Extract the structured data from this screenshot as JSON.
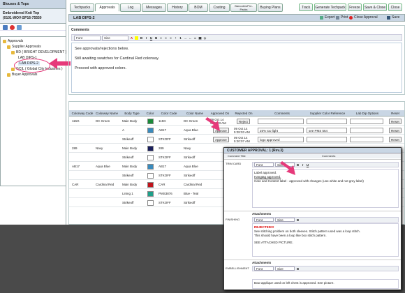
{
  "sidebar": {
    "title": "Blouses & Tops",
    "subtitle1": "Embroidered Knit Top",
    "subtitle2": "(0101-WOV-SP16-75550",
    "tree": [
      "Approvals",
      "Supplier Approvals",
      "BD ( BRIGHT DEVELOPMENT )",
      "LAB DIPS-1",
      "LAB DIPS-2",
      "GCIL ( Global City Industries )",
      "Buyer Approvals"
    ]
  },
  "tabs": [
    "Techpacks",
    "Approvals",
    "Log",
    "Messages",
    "History",
    "BOM",
    "Costing",
    "Barcodes/Pre-Packs",
    "Buying Plans"
  ],
  "buttons": [
    "Track",
    "Generate Techpack",
    "Freeze",
    "Save & Close",
    "Close"
  ],
  "header": {
    "title": "LAB DIPS-2",
    "export": "Export",
    "print": "Print",
    "close_approval": "Close Approval",
    "save": "Save"
  },
  "comments": {
    "label": "Comments",
    "font": "Font",
    "size": "Size",
    "lines": [
      "See approvals/rejections below.",
      "Still awaiting swatches for Cardinal Red colorway.",
      "Proceed with approved colors."
    ]
  },
  "grid": {
    "headers": [
      "Colorway Code",
      "Colorway Name",
      "Body Type",
      "Color",
      "Color Code",
      "Color Name",
      "Approved On",
      "Rejected On",
      "Comments",
      "Supplier Color Reference",
      "Lab Dip Options",
      "Reset"
    ],
    "rows": [
      {
        "cc": "115G",
        "cn": "DC Green",
        "bt": "Main Body",
        "sw": "#1b8a3a",
        "code": "115G",
        "name": "DC Green",
        "appr": "09 Oct 14\n5:28:03 AM",
        "rej": "Reject",
        "comm": "",
        "ref": "",
        "reset": "Reset"
      },
      {
        "cc": "",
        "cn": "",
        "bt": "A",
        "sw": "#3a8bbd",
        "code": "AB17",
        "name": "Aqua Blue",
        "appr": "Approve",
        "rej": "09 Oct 14\n5:28:03 AM",
        "comm": "25% too light",
        "ref": "see PMS 564",
        "reset": "Reset"
      },
      {
        "cc": "",
        "cn": "",
        "bt": "Strikeoff",
        "sw": "#ffffff",
        "code": "STKOFF",
        "name": "Strikeoff",
        "appr": "Approve",
        "rej": "09 Oct 14\n5:20:07 AM",
        "comm": "logo approved",
        "ref": "",
        "reset": "Reset"
      },
      {
        "cc": "289",
        "cn": "Navy",
        "bt": "Main Body",
        "sw": "#1a1f5c",
        "code": "289",
        "name": "Navy",
        "appr": "",
        "rej": "",
        "comm": "",
        "ref": "",
        "reset": ""
      },
      {
        "cc": "",
        "cn": "",
        "bt": "Strikeoff",
        "sw": "#ffffff",
        "code": "STKOFF",
        "name": "Strikeoff",
        "appr": "",
        "rej": "",
        "comm": "",
        "ref": "",
        "reset": ""
      },
      {
        "cc": "AB17",
        "cn": "Aqua Blue",
        "bt": "Main Body",
        "sw": "#3a8bbd",
        "code": "AB17",
        "name": "Aqua Blue",
        "appr": "",
        "rej": "",
        "comm": "",
        "ref": "",
        "reset": ""
      },
      {
        "cc": "",
        "cn": "",
        "bt": "Strikeoff",
        "sw": "#ffffff",
        "code": "STKOFF",
        "name": "Strikeoff",
        "appr": "",
        "rej": "",
        "comm": "",
        "ref": "",
        "reset": ""
      },
      {
        "cc": "CAR",
        "cn": "Cardinal Red",
        "bt": "Main Body",
        "sw": "#c0141c",
        "code": "CAR",
        "name": "Cardinal Red",
        "appr": "",
        "rej": "",
        "comm": "",
        "ref": "",
        "reset": ""
      },
      {
        "cc": "",
        "cn": "",
        "bt": "Lining 1",
        "sw": "#1fa08a",
        "code": "PMS3876",
        "name": "Blue - Teal",
        "appr": "",
        "rej": "",
        "comm": "",
        "ref": "",
        "reset": ""
      },
      {
        "cc": "",
        "cn": "",
        "bt": "Strikeoff",
        "sw": "#ffffff",
        "code": "STKOFF",
        "name": "Strikeoff",
        "appr": "",
        "rej": "",
        "comm": "",
        "ref": "",
        "reset": ""
      }
    ]
  },
  "popup": {
    "title": "CUSTOMER APPROVAL: 1 (Rev.3)",
    "col1": "Comment Title",
    "col2": "Comments",
    "sections": [
      {
        "label": "TRIM CARD",
        "lines": [
          "Label approved.",
          "Hangtag approved.",
          "Care and Content label - approved with changes (use white and not grey label)"
        ]
      },
      {
        "label": "FINISHING",
        "attach": "Attachments",
        "lines": [
          "REJECTED!!!",
          "See stitching problem on both sleeves.  Stitch pattern used was a loop stitch.",
          "This should have been a loop like box stitch pattern.",
          "",
          "SEE ATTACHED PICTURE."
        ]
      },
      {
        "label": "EMBELLISHMENT",
        "attach": "Attachments",
        "lines": [
          "Bow applique used on left chest is approved.  See picture."
        ]
      }
    ]
  },
  "colors": {
    "accent": "#e6397a",
    "header": "#c9d6e4"
  }
}
